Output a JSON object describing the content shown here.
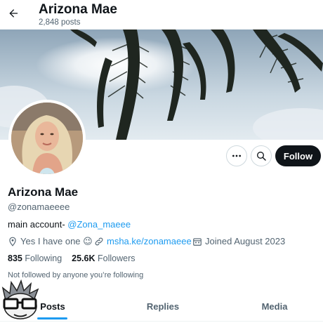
{
  "header": {
    "title": "Arizona Mae",
    "posts_count": "2,848 posts"
  },
  "profile": {
    "name": "Arizona Mae",
    "handle": "@zonamaeeee",
    "bio_prefix": "main account- ",
    "bio_mention": "@Zona_maeee",
    "location": "Yes I have one 😉",
    "website": "msha.ke/zonamaeee",
    "joined": "Joined August 2023",
    "following_count": "835",
    "following_label": "Following",
    "followers_count": "25.6K",
    "followers_label": "Followers",
    "not_followed_note": "Not followed by anyone you’re following"
  },
  "actions": {
    "follow_label": "Follow"
  },
  "tabs": [
    {
      "label": "Posts",
      "active": true
    },
    {
      "label": "Replies",
      "active": false
    },
    {
      "label": "Media",
      "active": false
    }
  ],
  "colors": {
    "accent": "#1d9bf0",
    "text": "#0f1419",
    "secondary": "#536471",
    "button_dark": "#0f1419"
  },
  "icons": [
    "back-arrow-icon",
    "more-icon",
    "search-icon",
    "location-icon",
    "link-icon",
    "calendar-icon"
  ]
}
